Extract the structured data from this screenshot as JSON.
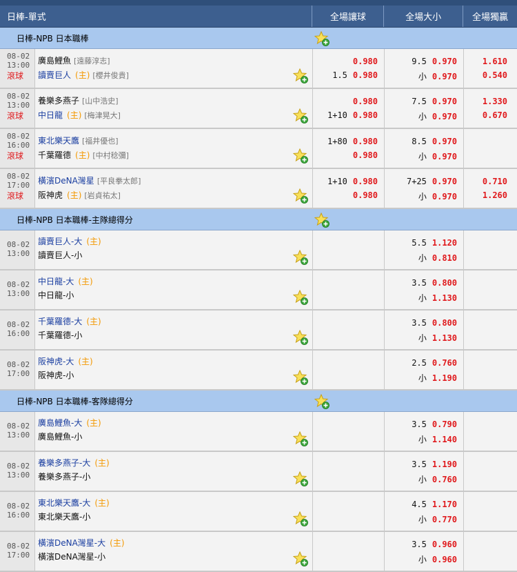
{
  "header": {
    "title": "日棒-單式",
    "col_handicap": "全場讓球",
    "col_overunder": "全場大小",
    "col_moneyline": "全場獨贏"
  },
  "live_label": "滾球",
  "leagues": [
    {
      "name": "日棒-NPB 日本職棒",
      "matches": [
        {
          "date": "08-02",
          "time": "13:00",
          "live": true,
          "team1": "廣島鯉魚",
          "team1_pitcher": "[遠藤淳志]",
          "team1_home": "",
          "team2": "讀賣巨人",
          "team2_pitcher": "[櫻井俊貴]",
          "team2_home": "(主)",
          "team1_color": "blk",
          "team2_color": "blue",
          "hcp1": "",
          "hcp1_odds": "0.980",
          "hcp2": "1.5",
          "hcp2_odds": "0.980",
          "ou1": "9.5",
          "ou1_odds": "0.970",
          "ou2": "小",
          "ou2_odds": "0.970",
          "ml1": "1.610",
          "ml2": "0.540"
        },
        {
          "date": "08-02",
          "time": "13:00",
          "live": true,
          "team1": "養樂多燕子",
          "team1_pitcher": "[山中浩史]",
          "team1_home": "",
          "team2": "中日龍",
          "team2_pitcher": "[梅津晃大]",
          "team2_home": "(主)",
          "team1_color": "blk",
          "team2_color": "blue",
          "hcp1": "",
          "hcp1_odds": "0.980",
          "hcp2": "1+10",
          "hcp2_odds": "0.980",
          "ou1": "7.5",
          "ou1_odds": "0.970",
          "ou2": "小",
          "ou2_odds": "0.970",
          "ml1": "1.330",
          "ml2": "0.670"
        },
        {
          "date": "08-02",
          "time": "16:00",
          "live": true,
          "team1": "東北樂天鷹",
          "team1_pitcher": "[福井優也]",
          "team1_home": "",
          "team2": "千葉羅德",
          "team2_pitcher": "[中村稔彌]",
          "team2_home": "(主)",
          "team1_color": "blue",
          "team2_color": "blk",
          "hcp1": "1+80",
          "hcp1_odds": "0.980",
          "hcp2": "",
          "hcp2_odds": "0.980",
          "ou1": "8.5",
          "ou1_odds": "0.970",
          "ou2": "小",
          "ou2_odds": "0.970",
          "ml1": "",
          "ml2": ""
        },
        {
          "date": "08-02",
          "time": "17:00",
          "live": true,
          "team1": "橫濱DeNA灣星",
          "team1_pitcher": "[平良拳太郎]",
          "team1_home": "",
          "team2": "阪神虎",
          "team2_pitcher": "[岩貞祐太]",
          "team2_home": "(主)",
          "team1_color": "blue",
          "team2_color": "blk",
          "hcp1": "1+10",
          "hcp1_odds": "0.980",
          "hcp2": "",
          "hcp2_odds": "0.980",
          "ou1": "7+25",
          "ou1_odds": "0.970",
          "ou2": "小",
          "ou2_odds": "0.970",
          "ml1": "0.710",
          "ml2": "1.260"
        }
      ]
    },
    {
      "name": "日棒-NPB 日本職棒-主隊總得分",
      "matches": [
        {
          "date": "08-02",
          "time": "13:00",
          "team1": "讀賣巨人-大",
          "team1_home": "(主)",
          "team2": "讀賣巨人-小",
          "ou1": "5.5",
          "ou1_odds": "1.120",
          "ou2": "小",
          "ou2_odds": "0.810"
        },
        {
          "date": "08-02",
          "time": "13:00",
          "team1": "中日龍-大",
          "team1_home": "(主)",
          "team2": "中日龍-小",
          "ou1": "3.5",
          "ou1_odds": "0.800",
          "ou2": "小",
          "ou2_odds": "1.130"
        },
        {
          "date": "08-02",
          "time": "16:00",
          "team1": "千葉羅德-大",
          "team1_home": "(主)",
          "team2": "千葉羅德-小",
          "ou1": "3.5",
          "ou1_odds": "0.800",
          "ou2": "小",
          "ou2_odds": "1.130"
        },
        {
          "date": "08-02",
          "time": "17:00",
          "team1": "阪神虎-大",
          "team1_home": "(主)",
          "team2": "阪神虎-小",
          "ou1": "2.5",
          "ou1_odds": "0.760",
          "ou2": "小",
          "ou2_odds": "1.190"
        }
      ]
    },
    {
      "name": "日棒-NPB 日本職棒-客隊總得分",
      "matches": [
        {
          "date": "08-02",
          "time": "13:00",
          "team1": "廣島鯉魚-大",
          "team1_home": "(主)",
          "team2": "廣島鯉魚-小",
          "ou1": "3.5",
          "ou1_odds": "0.790",
          "ou2": "小",
          "ou2_odds": "1.140"
        },
        {
          "date": "08-02",
          "time": "13:00",
          "team1": "養樂多燕子-大",
          "team1_home": "(主)",
          "team2": "養樂多燕子-小",
          "ou1": "3.5",
          "ou1_odds": "1.190",
          "ou2": "小",
          "ou2_odds": "0.760"
        },
        {
          "date": "08-02",
          "time": "16:00",
          "team1": "東北樂天鷹-大",
          "team1_home": "(主)",
          "team2": "東北樂天鷹-小",
          "ou1": "4.5",
          "ou1_odds": "1.170",
          "ou2": "小",
          "ou2_odds": "0.770"
        },
        {
          "date": "08-02",
          "time": "17:00",
          "team1": "橫濱DeNA灣星-大",
          "team1_home": "(主)",
          "team2": "橫濱DeNA灣星-小",
          "ou1": "3.5",
          "ou1_odds": "0.960",
          "ou2": "小",
          "ou2_odds": "0.960"
        }
      ]
    }
  ],
  "colors": {
    "header_bg": "#3d5f8f",
    "league_bg": "#a9c8ee",
    "odds": "#e0191c",
    "team_blue": "#1a3ea0",
    "home_tag": "#f39800",
    "live": "#e0191c"
  },
  "icons": {
    "favorite": "star-add-icon"
  }
}
